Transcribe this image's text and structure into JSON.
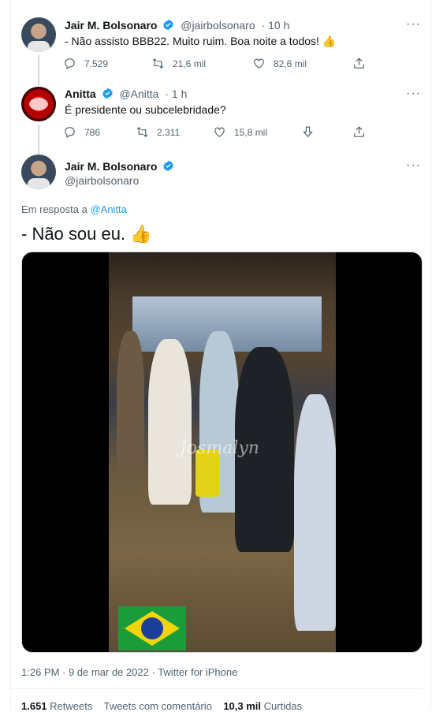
{
  "tweets": [
    {
      "name": "Jair M. Bolsonaro",
      "handle": "@jairbolsonaro",
      "time": "· 10 h",
      "text": "- Não assisto BBB22. Muito ruim. Boa noite a todos! 👍",
      "stats": {
        "replies": "7.529",
        "retweets": "21,6 mil",
        "likes": "82,6 mil"
      }
    },
    {
      "name": "Anitta",
      "handle": "@Anitta",
      "time": "· 1 h",
      "text": "É presidente ou subcelebridade?",
      "stats": {
        "replies": "786",
        "retweets": "2.311",
        "likes": "15,8 mil"
      }
    }
  ],
  "main_tweet": {
    "name": "Jair M. Bolsonaro",
    "handle": "@jairbolsonaro",
    "reply_prefix": "Em resposta a",
    "reply_to": "@Anitta",
    "text": "- Não sou eu. 👍",
    "media_watermark": "Josmalyn",
    "timestamp": "1:26 PM · 9 de mar de 2022 · Twitter for iPhone",
    "stats_partial": {
      "retweets_count": "1.651",
      "retweets_label": "Retweets",
      "quotes_label": "Tweets com comentário",
      "likes_count": "10,3 mil",
      "likes_label": "Curtidas"
    }
  },
  "icons": [
    "verified-badge-icon",
    "more-icon",
    "reply-icon",
    "retweet-icon",
    "like-icon",
    "share-icon",
    "downvote-icon"
  ],
  "colors": {
    "accent": "#1d9bf0",
    "muted": "#536471",
    "text": "#0f1419",
    "border": "#eff3f4"
  }
}
